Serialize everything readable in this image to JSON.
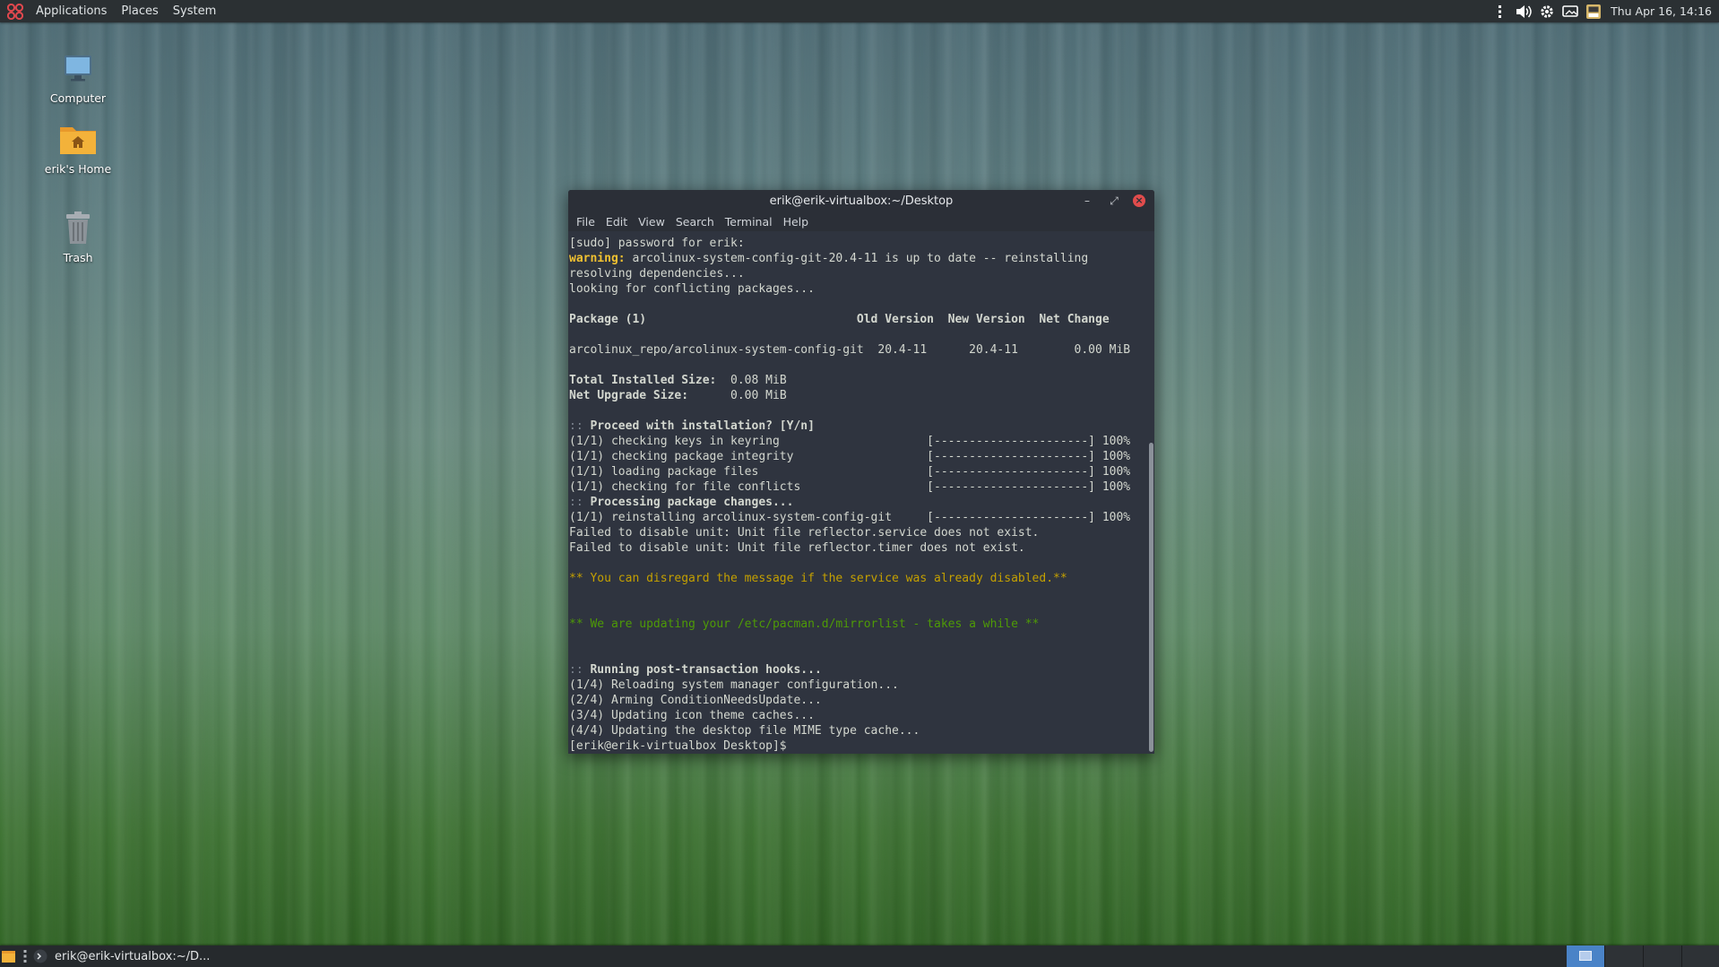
{
  "top_panel": {
    "menus": [
      "Applications",
      "Places",
      "System"
    ],
    "clock": "Thu Apr 16, 14:16"
  },
  "desktop_icons": [
    {
      "label": "Computer"
    },
    {
      "label": "erik's Home"
    },
    {
      "label": "Trash"
    }
  ],
  "terminal": {
    "title": "erik@erik-virtualbox:~/Desktop",
    "menu": [
      "File",
      "Edit",
      "View",
      "Search",
      "Terminal",
      "Help"
    ],
    "lines": [
      "[sudo] password for erik:",
      "arcolinux-system-config-git-20.4-11 is up to date -- reinstalling",
      "resolving dependencies...",
      "looking for conflicting packages...",
      "",
      "Package (1)                              Old Version  New Version  Net Change",
      "",
      "arcolinux_repo/arcolinux-system-config-git  20.4-11      20.4-11        0.00 MiB",
      "",
      "0.08 MiB",
      "0.00 MiB",
      "",
      "Proceed with installation? [Y/n]",
      "(1/1) checking keys in keyring                     [----------------------] 100%",
      "(1/1) checking package integrity                   [----------------------] 100%",
      "(1/1) loading package files                        [----------------------] 100%",
      "(1/1) checking for file conflicts                  [----------------------] 100%",
      "Processing package changes...",
      "(1/1) reinstalling arcolinux-system-config-git     [----------------------] 100%",
      "Failed to disable unit: Unit file reflector.service does not exist.",
      "Failed to disable unit: Unit file reflector.timer does not exist.",
      "",
      "** You can disregard the message if the service was already disabled.**",
      "",
      "",
      "** We are updating your /etc/pacman.d/mirrorlist - takes a while **",
      "",
      "",
      "Running post-transaction hooks...",
      "(1/4) Reloading system manager configuration...",
      "(2/4) Arming ConditionNeedsUpdate...",
      "(3/4) Updating icon theme caches...",
      "(4/4) Updating the desktop file MIME type cache...",
      "[erik@erik-virtualbox Desktop]$"
    ],
    "warning_prefix": "warning:",
    "total_installed_label": "Total Installed Size:",
    "net_upgrade_label": "Net Upgrade Size:",
    "prompt_prefix": "::"
  },
  "taskbar": {
    "task_label": "erik@erik-virtualbox:~/D..."
  },
  "colors": {
    "panel": "#2b3033",
    "terminal_bg": "#2f343f",
    "warning": "#f0c131",
    "note_yellow": "#c4a000",
    "note_green": "#4e9a06",
    "close_button": "#e14c4c",
    "workspace_active": "#4a83c7"
  }
}
